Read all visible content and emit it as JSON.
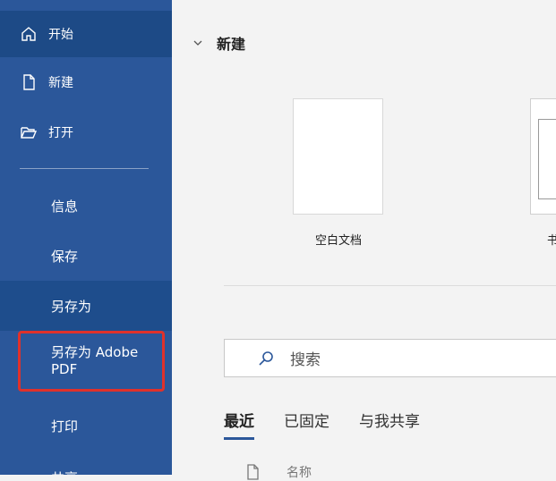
{
  "sidebar": {
    "items": [
      {
        "label": "开始",
        "icon": "home-icon"
      },
      {
        "label": "新建",
        "icon": "new-document-icon"
      },
      {
        "label": "打开",
        "icon": "open-folder-icon"
      },
      {
        "label": "信息"
      },
      {
        "label": "保存"
      },
      {
        "label": "另存为"
      },
      {
        "label": "另存为 Adobe PDF"
      },
      {
        "label": "打印"
      },
      {
        "label": "共享"
      }
    ]
  },
  "main": {
    "section_title": "新建",
    "templates": [
      {
        "label": "空白文档"
      },
      {
        "label": "书"
      }
    ],
    "search": {
      "placeholder": "搜索"
    },
    "tabs": [
      {
        "label": "最近"
      },
      {
        "label": "已固定"
      },
      {
        "label": "与我共享"
      }
    ],
    "list_header": {
      "name_column": "名称"
    }
  },
  "colors": {
    "sidebar_bg": "#2b579a",
    "sidebar_active": "#1d4a86",
    "highlight_border": "#e0312b",
    "tab_underline": "#2b579a"
  }
}
